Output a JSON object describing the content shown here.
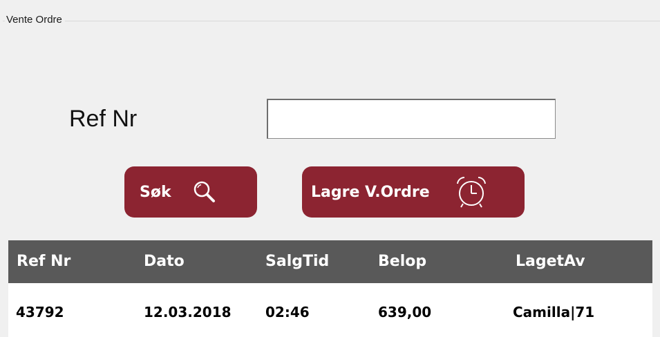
{
  "groupbox": {
    "title": "Vente Ordre"
  },
  "form": {
    "ref_label": "Ref Nr",
    "ref_value": "",
    "ref_placeholder": ""
  },
  "buttons": {
    "search_label": "Søk",
    "search_icon": "magnifier-icon",
    "save_label": "Lagre V.Ordre",
    "save_icon": "alarm-clock-icon",
    "color": "#8c2431"
  },
  "grid": {
    "header_color": "#595959",
    "columns": [
      "Ref Nr",
      "Dato",
      "SalgTid",
      "Belop",
      "LagetAv"
    ],
    "rows": [
      [
        "43792",
        "12.03.2018",
        "02:46",
        "639,00",
        "Camilla|71"
      ]
    ]
  }
}
